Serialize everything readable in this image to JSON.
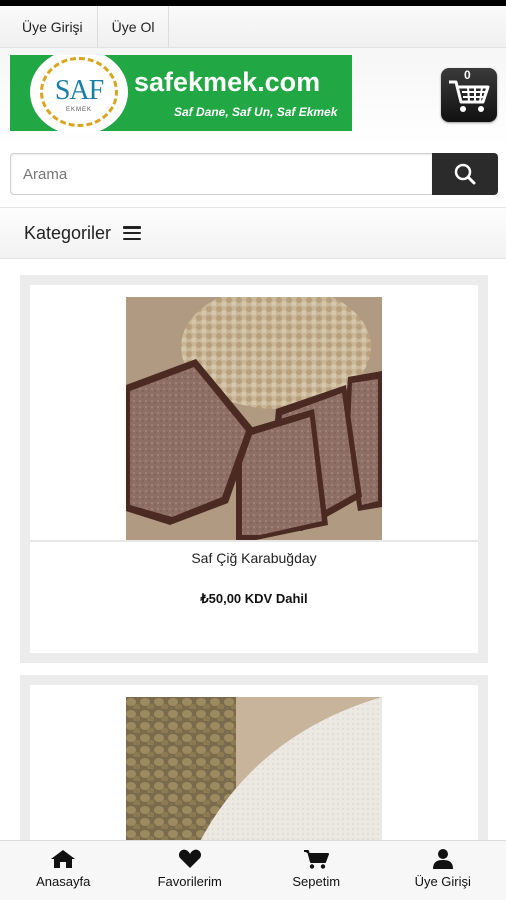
{
  "top_links": {
    "login": "Üye Girişi",
    "register": "Üye Ol"
  },
  "logo": {
    "seal_text": "SAF",
    "seal_sub": "EKMEK",
    "site_name": "safekmek.com",
    "tagline": "Saf Dane, Saf Un, Saf Ekmek",
    "brand_color": "#22a745"
  },
  "cart": {
    "count": "0",
    "icon": "shopping-cart-icon"
  },
  "search": {
    "placeholder": "Arama",
    "value": "",
    "icon": "search-icon"
  },
  "categories": {
    "label": "Kategoriler",
    "icon": "hamburger-menu-icon"
  },
  "products": [
    {
      "name": "Saf Çiğ Karabuğday",
      "price": "₺50,00 KDV Dahil"
    }
  ],
  "bottom_nav": [
    {
      "label": "Anasayfa",
      "icon": "home-icon"
    },
    {
      "label": "Favorilerim",
      "icon": "heart-icon"
    },
    {
      "label": "Sepetim",
      "icon": "cart-icon"
    },
    {
      "label": "Üye Girişi",
      "icon": "user-icon"
    }
  ]
}
